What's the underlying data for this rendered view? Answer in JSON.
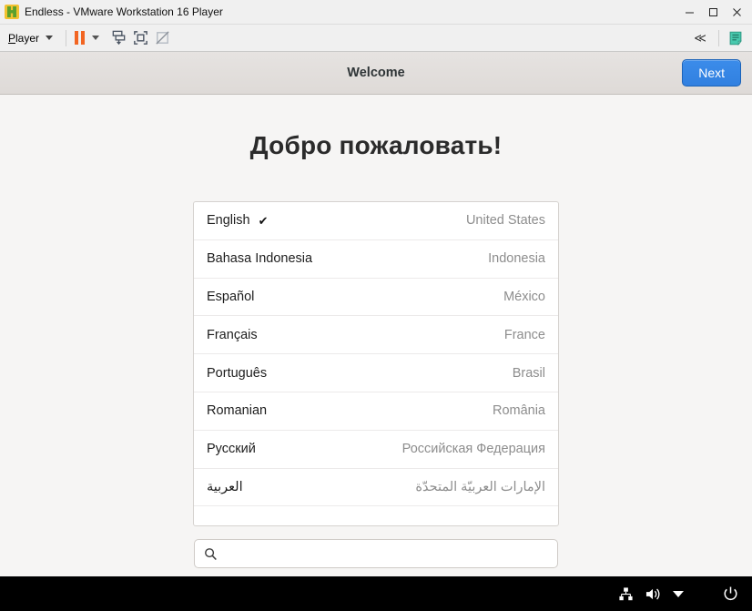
{
  "window": {
    "title": "Endless - VMware Workstation 16 Player",
    "app_icon": "vmware-logo-icon",
    "controls": {
      "minimize": "–",
      "maximize": "☐",
      "close": "✕"
    }
  },
  "toolbar": {
    "player_menu": "Player",
    "player_menu_accel": "P",
    "items": [
      {
        "name": "pause-button",
        "icon": "pause-icon"
      },
      {
        "name": "pause-dropdown",
        "icon": "caret-down-icon"
      },
      {
        "name": "send-ctrl-alt-del-button",
        "icon": "send-key-icon"
      },
      {
        "name": "full-screen-button",
        "icon": "fullscreen-icon"
      },
      {
        "name": "unity-mode-button",
        "icon": "unity-disabled-icon"
      }
    ],
    "collapse_icon": "≪",
    "note_icon": "notes-icon"
  },
  "guest": {
    "headerbar": {
      "title": "Welcome",
      "next_label": "Next"
    },
    "heading": "Добро пожаловать!",
    "languages": [
      {
        "name": "English",
        "country": "United States",
        "selected": true,
        "rtl": false,
        "check": "✔"
      },
      {
        "name": "Bahasa Indonesia",
        "country": "Indonesia",
        "selected": false,
        "rtl": false,
        "check": ""
      },
      {
        "name": "Español",
        "country": "México",
        "selected": false,
        "rtl": false,
        "check": ""
      },
      {
        "name": "Français",
        "country": "France",
        "selected": false,
        "rtl": false,
        "check": ""
      },
      {
        "name": "Português",
        "country": "Brasil",
        "selected": false,
        "rtl": false,
        "check": ""
      },
      {
        "name": "Romanian",
        "country": "România",
        "selected": false,
        "rtl": false,
        "check": ""
      },
      {
        "name": "Русский",
        "country": "Российская Федерация",
        "selected": false,
        "rtl": false,
        "check": ""
      },
      {
        "name": "العربية",
        "country": "الإمارات العربيّة المتحدّة",
        "selected": false,
        "rtl": true,
        "check": ""
      }
    ],
    "search": {
      "value": "",
      "placeholder": "",
      "icon": "search-icon"
    },
    "taskbar": {
      "network_icon": "network-icon",
      "volume_icon": "volume-icon",
      "menu_caret_icon": "chevron-down-icon",
      "power_icon": "power-icon"
    }
  },
  "colors": {
    "accent_blue": "#3584e4",
    "vm_orange": "#f26522",
    "panel_bg": "#ffffff",
    "page_bg": "#f6f5f4",
    "headerbar_bg": "#e1dedb",
    "taskbar_bg": "#000000"
  }
}
